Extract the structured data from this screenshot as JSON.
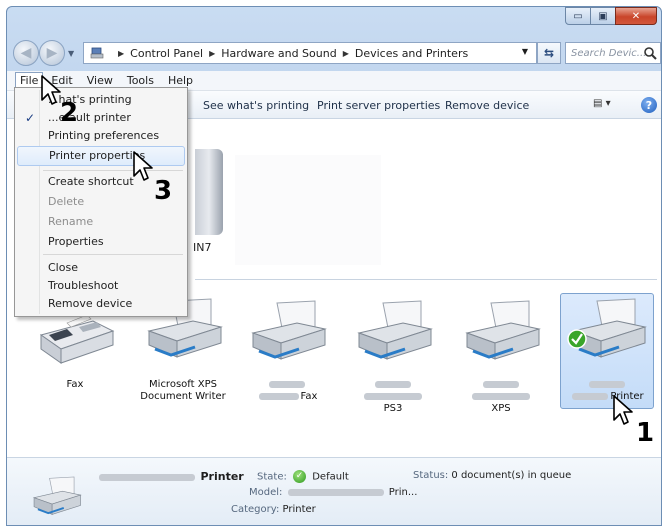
{
  "window": {
    "controls": {
      "minimize": "▭",
      "maximize": "▣",
      "close": "✕"
    }
  },
  "address": {
    "crumbs": [
      "Control Panel",
      "Hardware and Sound",
      "Devices and Printers"
    ],
    "search_placeholder": "Search Devic..."
  },
  "menubar": {
    "items": [
      {
        "label": "File",
        "accel": "F"
      },
      {
        "label": "Edit",
        "accel": "E"
      },
      {
        "label": "View",
        "accel": "V"
      },
      {
        "label": "Tools",
        "accel": "T"
      },
      {
        "label": "Help",
        "accel": "H"
      }
    ]
  },
  "cmdbar": {
    "see_whats_printing": "See what's printing",
    "print_server_properties": "Print server properties",
    "remove_device": "Remove device"
  },
  "file_menu": {
    "items": [
      {
        "label": "See what's printing",
        "shown": "...hat's printing",
        "state": "normal"
      },
      {
        "label": "Set as default printer",
        "shown": "...efault printer",
        "state": "checked"
      },
      {
        "label": "Printing preferences",
        "state": "normal"
      },
      {
        "label": "Printer properties",
        "state": "highlighted"
      },
      {
        "label": "Create shortcut",
        "state": "normal"
      },
      {
        "label": "Delete",
        "state": "disabled"
      },
      {
        "label": "Rename",
        "state": "disabled"
      },
      {
        "label": "Properties",
        "state": "normal"
      },
      {
        "label": "Close",
        "state": "normal"
      },
      {
        "label": "Troubleshoot",
        "state": "normal"
      },
      {
        "label": "Remove device",
        "state": "normal"
      }
    ]
  },
  "devices": {
    "partial_label": "IN7"
  },
  "printers": [
    {
      "label": "Fax"
    },
    {
      "label": "Microsoft XPS Document Writer",
      "line1": "Microsoft XPS",
      "line2": "Document Writer"
    },
    {
      "label": "Fax",
      "redacted": true
    },
    {
      "label": "PS3",
      "redacted": true
    },
    {
      "label": "XPS",
      "redacted": true
    },
    {
      "label": "Printer",
      "redacted": true,
      "selected": true,
      "default": true
    }
  ],
  "details": {
    "name_suffix": "Printer",
    "state_key": "State:",
    "state_value": "Default",
    "status_key": "Status:",
    "status_value": "0 document(s) in queue",
    "model_key": "Model:",
    "model_suffix": "Prin...",
    "category_key": "Category:",
    "category_value": "Printer"
  },
  "steps": {
    "one": "1",
    "two": "2",
    "three": "3"
  },
  "colors": {
    "accent": "#2b4c7e",
    "selection": "#c4dcf8",
    "close": "#c9452a"
  }
}
